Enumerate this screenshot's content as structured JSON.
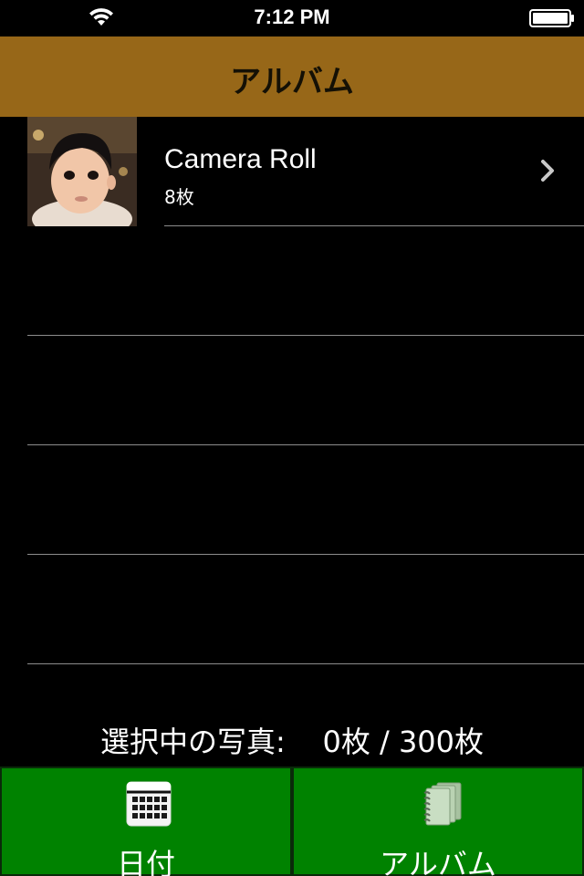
{
  "status_bar": {
    "time": "7:12 PM",
    "icons": [
      "wifi-icon",
      "battery-icon"
    ]
  },
  "nav": {
    "title": "アルバム",
    "background": "#976718"
  },
  "albums": [
    {
      "name": "Camera Roll",
      "count": "8枚",
      "thumbnail": "child-photo"
    }
  ],
  "selection": {
    "label": "選択中の写真:",
    "value": "0枚 / 300枚"
  },
  "tabs": [
    {
      "label": "日付",
      "icon": "calendar-icon"
    },
    {
      "label": "アルバム",
      "icon": "album-stack-icon"
    }
  ],
  "colors": {
    "tab_green": "#008200",
    "text": "#ffffff",
    "separator": "#8c8c8c"
  }
}
